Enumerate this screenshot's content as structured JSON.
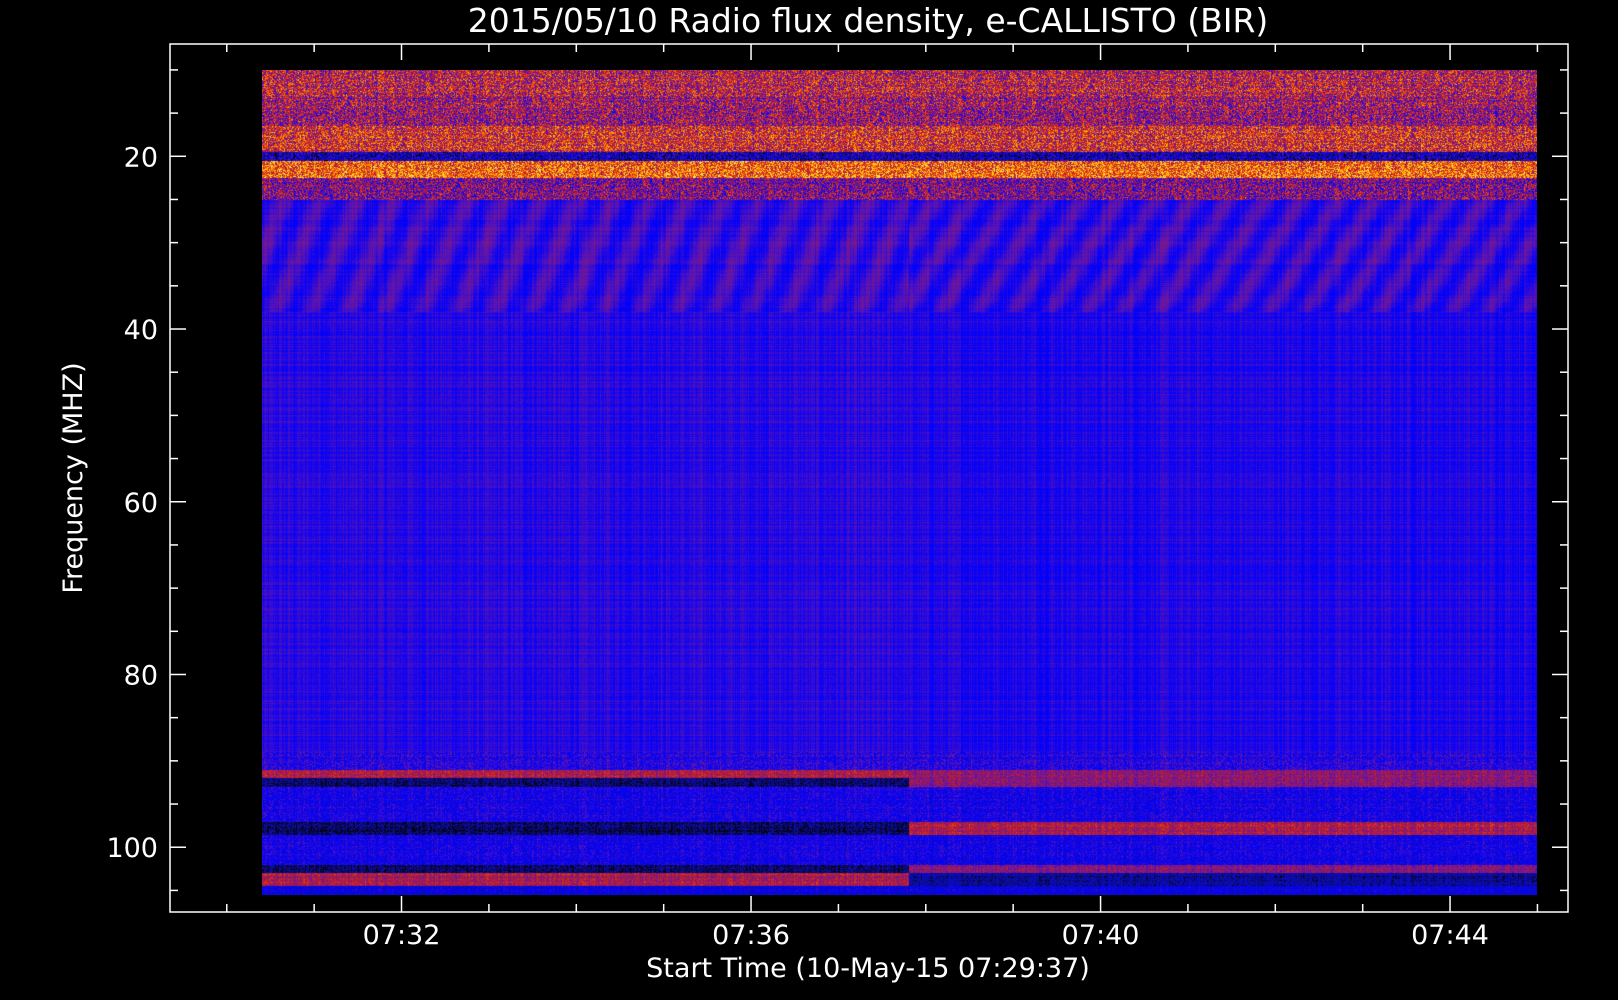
{
  "chart_data": {
    "type": "heatmap",
    "title": "2015/05/10  Radio flux density, e-CALLISTO (BIR)",
    "xlabel": "Start Time (10-May-15 07:29:37)",
    "ylabel": "Frequency (MHZ)",
    "x_ticks": [
      {
        "value": 7.53333,
        "label": "07:32"
      },
      {
        "value": 7.6,
        "label": "07:36"
      },
      {
        "value": 7.66667,
        "label": "07:40"
      },
      {
        "value": 7.73333,
        "label": "07:44"
      }
    ],
    "y_ticks": [
      {
        "value": 20,
        "label": "20"
      },
      {
        "value": 40,
        "label": "40"
      },
      {
        "value": 60,
        "label": "60"
      },
      {
        "value": 80,
        "label": "80"
      },
      {
        "value": 100,
        "label": "100"
      }
    ],
    "x_unit": "hours (UT)",
    "xlim": [
      7.48917,
      7.75583
    ],
    "xdata": [
      7.50667,
      7.75
    ],
    "ylim": [
      107.5,
      7
    ],
    "ydata": [
      10,
      105.5
    ],
    "minor_y_step": 5,
    "minor_x_step_minutes": 1,
    "colormap": [
      "#000000",
      "#1010a0",
      "#0000ff",
      "#5a14b4",
      "#c81e1e",
      "#ff5a00",
      "#ffc800",
      "#ffffa0"
    ],
    "regime_change_time": 7.63,
    "bands": [
      {
        "f0": 10,
        "f1": 13,
        "level": 0.55
      },
      {
        "f0": 13,
        "f1": 16.5,
        "level": 0.5
      },
      {
        "f0": 16.5,
        "f1": 19.5,
        "level": 0.6
      },
      {
        "f0": 19.5,
        "f1": 20.5,
        "level": 0.2
      },
      {
        "f0": 20.5,
        "f1": 22.5,
        "level": 0.7
      },
      {
        "f0": 22.5,
        "f1": 25,
        "level": 0.45
      },
      {
        "f0": 25,
        "f1": 38,
        "level": 0.37
      },
      {
        "f0": 38,
        "f1": 89,
        "level": 0.33
      },
      {
        "f0": 89,
        "f1": 91,
        "level": 0.34
      },
      {
        "f0": 91,
        "f1": 92,
        "level": 0.55
      },
      {
        "f0": 92,
        "f1": 93,
        "level": 0.1
      },
      {
        "f0": 93,
        "f1": 97,
        "level": 0.32
      },
      {
        "f0": 97,
        "f1": 98.5,
        "level": 0.08
      },
      {
        "f0": 98.5,
        "f1": 102,
        "level": 0.3
      },
      {
        "f0": 102,
        "f1": 103,
        "level": 0.1
      },
      {
        "f0": 103,
        "f1": 104.5,
        "level": 0.55
      },
      {
        "f0": 104.5,
        "f1": 105.5,
        "level": 0.25
      }
    ]
  }
}
